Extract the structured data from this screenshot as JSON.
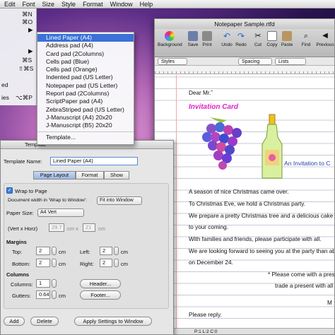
{
  "menubar": {
    "items": [
      "Edit",
      "Font",
      "Size",
      "Style",
      "Format",
      "Window",
      "Help"
    ]
  },
  "left_menu": {
    "shortcuts": [
      "⌘N",
      "⌘O",
      "▶",
      "▶",
      "⌘S",
      "⇧⌘S"
    ],
    "fragments": [
      "ed",
      "ies",
      "⌥⌘P",
      "..."
    ]
  },
  "submenu": {
    "items": [
      "Lined Paper (A4)",
      "Address pad (A4)",
      "Card pad (2Columns)",
      "Cells pad (Blue)",
      "Cells pad (Orange)",
      "Indented pad (US Letter)",
      "Notepaper pad (US Letter)",
      "Report pad (2Columns)",
      "ScriptPaper pad (A4)",
      "ZebraStriped pad (US Letter)",
      "J-Manuscript (A4) 20x20",
      "J-Manuscript (B5) 20x20"
    ],
    "template_item": "Template..."
  },
  "doc_window": {
    "title": "Notepaper Sample.rtfd",
    "toolbar": [
      "Background",
      "Save",
      "Print",
      "Undo",
      "Redo",
      "Cut",
      "Copy",
      "Paste",
      "Find",
      "Previous"
    ],
    "format_popups": [
      "Styles",
      "Spacing",
      "Lists"
    ],
    "greeting": "Dear Mr.˜",
    "card_title": "Invitation Card",
    "invitation_heading": "An Invitation to C",
    "lines": [
      "A season of nice Christmas came over.",
      "To Christmas Eve, we hold a Christmas party.",
      "We prepare a pretty Christmas tree and a delicious cake",
      "to your coming.",
      "With families and friends, please participate with all.",
      "We are looking forward to seeing you at the party than ab",
      "on December 24.",
      "* Please come with a preser",
      "trade a present with all th",
      "Please reply."
    ],
    "trailing_mark": "M",
    "status": "P:1  L:2  C:0"
  },
  "panel": {
    "title": "Template",
    "template_name_label": "Template Name:",
    "template_name_value": "Lined Paper (A4)",
    "tabs": [
      "Page Layout",
      "Format",
      "Show"
    ],
    "wrap_to_page": "Wrap to Page",
    "doc_width_label": "Document width in 'Wrap to Window':",
    "doc_width_value": "Fit into Window",
    "paper_size_label": "Paper Size:",
    "paper_size_value": "A4 Vert",
    "vert_horz_label": "(Vert x Horz)",
    "vert_value": "29.7",
    "cm_x": "cm x",
    "horz_value": "21",
    "unit": "cm",
    "margins_label": "Margins",
    "top_label": "Top:",
    "top_value": "2",
    "left_label": "Left:",
    "left_value": "2",
    "bottom_label": "Bottom:",
    "bottom_value": "2",
    "right_label": "Right:",
    "right_value": "2",
    "columns_section": "Columns",
    "columns_label": "Columns:",
    "columns_value": "1",
    "gutters_label": "Gutters:",
    "gutters_value": "0.64",
    "header_button": "Header...",
    "footer_button": "Footer...",
    "add_button": "Add",
    "delete_button": "Delete",
    "apply_button": "Apply Settings to Window"
  }
}
